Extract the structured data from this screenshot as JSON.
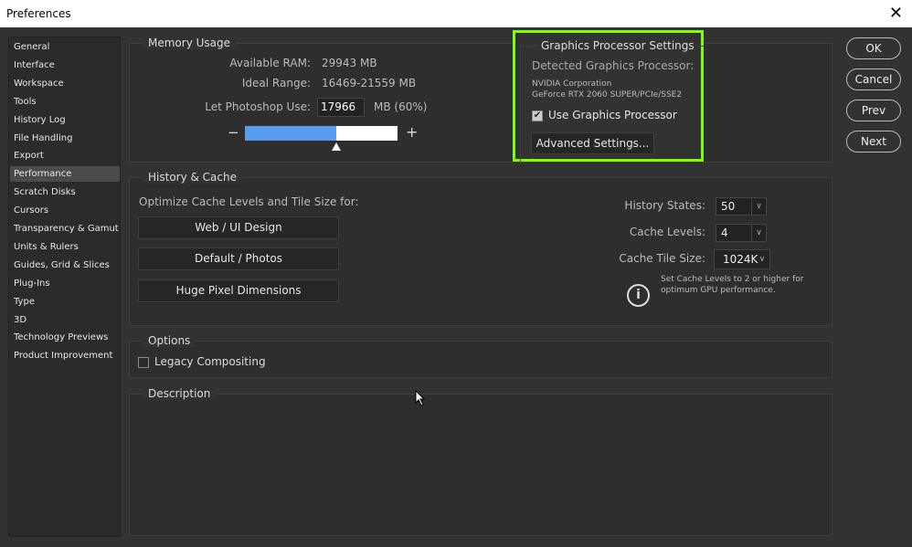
{
  "window": {
    "title": "Preferences",
    "close": "✕"
  },
  "sidebar": {
    "items": [
      {
        "label": "General"
      },
      {
        "label": "Interface"
      },
      {
        "label": "Workspace"
      },
      {
        "label": "Tools"
      },
      {
        "label": "History Log"
      },
      {
        "label": "File Handling"
      },
      {
        "label": "Export"
      },
      {
        "label": "Performance",
        "selected": true
      },
      {
        "label": "Scratch Disks"
      },
      {
        "label": "Cursors"
      },
      {
        "label": "Transparency & Gamut"
      },
      {
        "label": "Units & Rulers"
      },
      {
        "label": "Guides, Grid & Slices"
      },
      {
        "label": "Plug-Ins"
      },
      {
        "label": "Type"
      },
      {
        "label": "3D"
      },
      {
        "label": "Technology Previews"
      },
      {
        "label": "Product Improvement"
      }
    ]
  },
  "memory": {
    "title": "Memory Usage",
    "available_label": "Available RAM:",
    "available_value": "29943 MB",
    "ideal_label": "Ideal Range:",
    "ideal_value": "16469-21559 MB",
    "use_label": "Let Photoshop Use:",
    "use_value": "17966",
    "use_unit": "MB (60%)",
    "slider_percent": 60,
    "minus": "−",
    "plus": "+",
    "slider_color": "#5b9bf0"
  },
  "gpu": {
    "title": "Graphics Processor Settings",
    "detected_label": "Detected Graphics Processor:",
    "vendor": "NVIDIA Corporation",
    "model": "GeForce RTX 2060 SUPER/PCIe/SSE2",
    "use_label": "Use Graphics Processor",
    "use_checked": true,
    "advanced_label": "Advanced Settings...",
    "highlight_color": "#7fff00"
  },
  "buttons": {
    "ok": "OK",
    "cancel": "Cancel",
    "prev": "Prev",
    "next": "Next"
  },
  "history": {
    "title": "History & Cache",
    "optimize_label": "Optimize Cache Levels and Tile Size for:",
    "presets": [
      "Web / UI Design",
      "Default / Photos",
      "Huge Pixel Dimensions"
    ],
    "history_states_label": "History States:",
    "history_states": "50",
    "cache_levels_label": "Cache Levels:",
    "cache_levels": "4",
    "tile_size_label": "Cache Tile Size:",
    "tile_size": "1024K",
    "info_icon": "info-icon",
    "info_text_1": "Set Cache Levels to 2 or higher for",
    "info_text_2": "optimum GPU performance."
  },
  "options": {
    "title": "Options",
    "legacy_label": "Legacy Compositing",
    "legacy_checked": false
  },
  "description": {
    "title": "Description"
  }
}
